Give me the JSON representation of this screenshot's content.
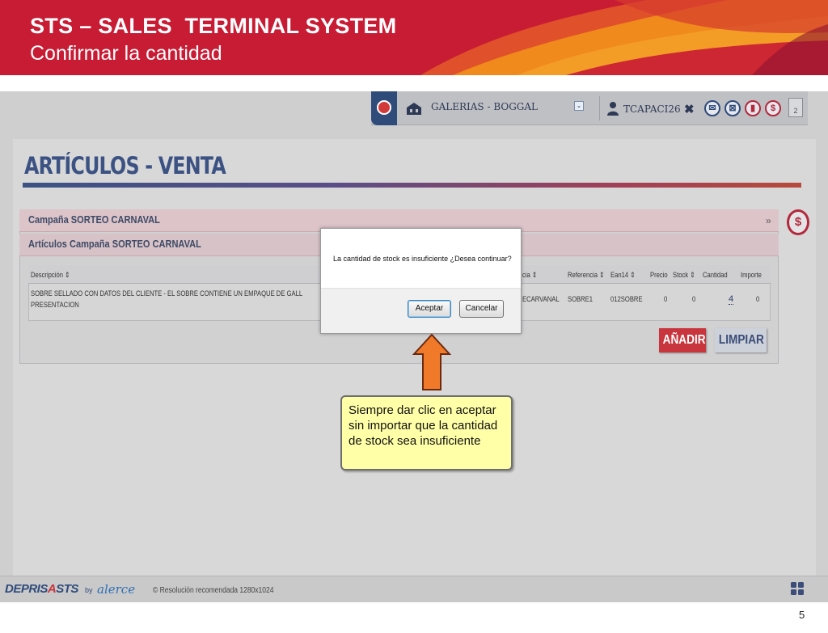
{
  "slide": {
    "title": "STS – SALES  TERMINAL SYSTEM",
    "subtitle": "Confirmar la cantidad",
    "page_number": "5"
  },
  "topbar": {
    "store_label": "GALERIAS - BOGGAL",
    "user_label": "TCAPACI26",
    "close_glyph": "✖",
    "button_glyphs": [
      "✉",
      "⊠",
      "▮",
      "$"
    ],
    "door_label": "2"
  },
  "page": {
    "heading": "ARTÍCULOS - VENTA",
    "campaign_label": "Campaña SORTEO CARNAVAL",
    "campaign_chevron": "»",
    "articles_label": "Artículos Campaña SORTEO CARNAVAL",
    "side_button_glyph": "$"
  },
  "grid": {
    "columns": {
      "descripcion": "Descripción ⇕",
      "familia": "cia ⇕",
      "referencia": "Referencia ⇕",
      "ean14": "Ean14 ⇕",
      "precio": "Precio",
      "stock": "Stock ⇕",
      "cantidad": "Cantidad",
      "importe": "Importe"
    },
    "row": {
      "descripcion_line1": "SOBRE SELLADO CON DATOS DEL CLIENTE - EL SOBRE CONTIENE UN EMPAQUE DE GALL",
      "descripcion_line2": "PRESENTACION",
      "familia": "ECARVANAL",
      "referencia": "SOBRE1",
      "ean14": "012SOBRE",
      "precio": "0",
      "stock": "0",
      "cantidad": "4",
      "importe": "0"
    }
  },
  "actions": {
    "add_label": "AÑADIR",
    "clear_label": "LIMPIAR"
  },
  "dialog": {
    "message": "La cantidad de stock es insuficiente ¿Desea continuar?",
    "ok_label": "Aceptar",
    "cancel_label": "Cancelar"
  },
  "footer": {
    "brand_part1": "DEPRIS",
    "brand_part2": "A",
    "brand_part3": "STS",
    "by": "by",
    "partner": "alerce",
    "resolution": "© Resolución recomendada 1280x1024"
  },
  "callout": {
    "text": "Siempre dar clic en aceptar sin importar que la cantidad de stock sea insuficiente"
  },
  "colors": {
    "banner_red": "#c81b34",
    "banner_orange": "#f08a1c",
    "navy": "#3b5283",
    "callout_yellow": "#ffffa8",
    "arrow_orange": "#f07a2a"
  }
}
